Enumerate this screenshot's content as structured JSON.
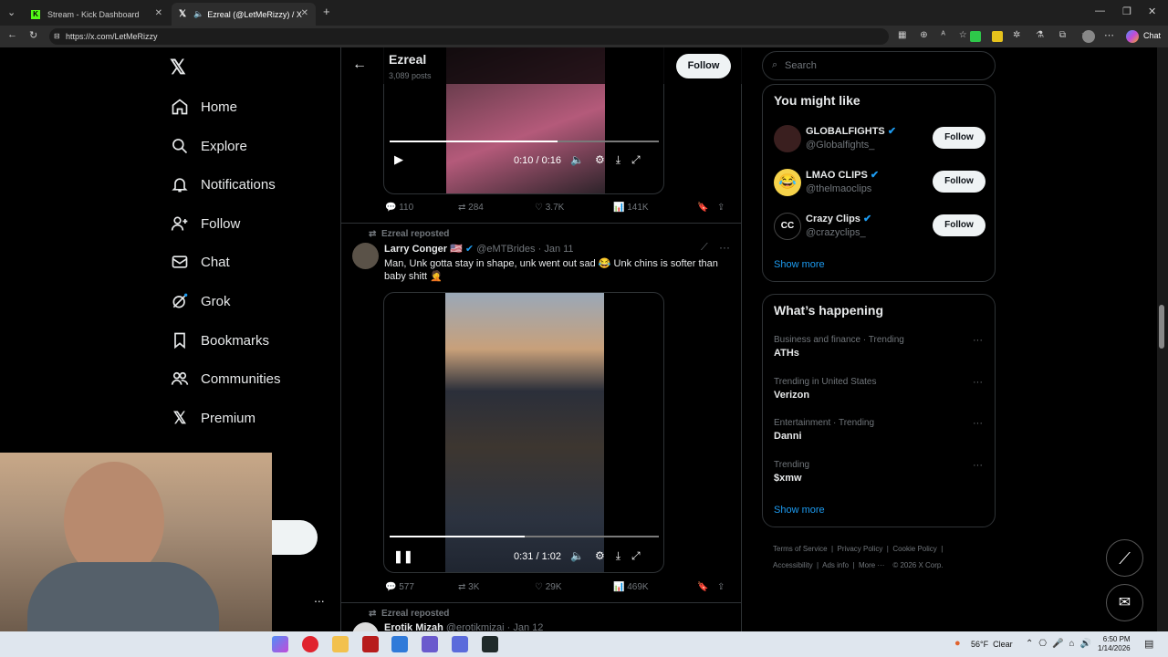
{
  "browser": {
    "tabs": [
      {
        "title": "Stream - Kick Dashboard"
      },
      {
        "title": "Ezreal (@LetMeRizzy) / X"
      }
    ],
    "url": "https://x.com/LetMeRizzy",
    "chat_label": "Chat"
  },
  "sidebar": {
    "items": [
      {
        "label": "Home",
        "icon": "home-icon"
      },
      {
        "label": "Explore",
        "icon": "search-icon"
      },
      {
        "label": "Notifications",
        "icon": "bell-icon"
      },
      {
        "label": "Follow",
        "icon": "person-add-icon"
      },
      {
        "label": "Chat",
        "icon": "mail-icon"
      },
      {
        "label": "Grok",
        "icon": "grok-icon"
      },
      {
        "label": "Bookmarks",
        "icon": "bookmark-icon"
      },
      {
        "label": "Communities",
        "icon": "people-icon"
      },
      {
        "label": "Premium",
        "icon": "x-icon"
      }
    ],
    "more_dots": "..."
  },
  "header": {
    "name": "Ezreal",
    "posts": "3,089 posts",
    "follow_label": "Follow"
  },
  "post1": {
    "time": "0:10 / 0:16",
    "replies": "110",
    "reposts": "284",
    "likes": "3.7K",
    "views": "141K"
  },
  "post2": {
    "repost_label": "Ezreal reposted",
    "author": "Larry Conger",
    "handle": "@eMTBrides",
    "date": "· Jan 11",
    "text": "Man, Unk gotta stay in shape, unk went out sad 😂 Unk chins is softer than baby shitt 🤦",
    "time": "0:31 / 1:02",
    "replies": "577",
    "reposts": "3K",
    "likes": "29K",
    "views": "469K"
  },
  "post3": {
    "repost_label": "Ezreal reposted",
    "author": "Erotik Mizah",
    "handle": "@erotikmizai",
    "date": "· Jan 12"
  },
  "search": {
    "placeholder": "Search"
  },
  "you_might_like": {
    "title": "You might like",
    "accounts": [
      {
        "name": "GLOBALFIGHTS",
        "handle": "@Globalfights_",
        "follow": "Follow"
      },
      {
        "name": "LMAO CLIPS",
        "handle": "@thelmaoclips",
        "follow": "Follow"
      },
      {
        "name": "Crazy Clips",
        "handle": "@crazyclips_",
        "follow": "Follow"
      }
    ],
    "show_more": "Show more"
  },
  "happening": {
    "title": "What’s happening",
    "trends": [
      {
        "category": "Business and finance · Trending",
        "name": "ATHs"
      },
      {
        "category": "Trending in United States",
        "name": "Verizon"
      },
      {
        "category": "Entertainment · Trending",
        "name": "Danni"
      },
      {
        "category": "Trending",
        "name": "$xmw"
      }
    ],
    "show_more": "Show more"
  },
  "footer": {
    "links": [
      "Terms of Service",
      "Privacy Policy",
      "Cookie Policy",
      "Accessibility",
      "Ads info",
      "More ···",
      "© 2026 X Corp."
    ]
  },
  "taskbar": {
    "weather": "56°F",
    "weather_desc": "Clear",
    "time": "6:50 PM",
    "date": "1/14/2026"
  },
  "colors": {
    "verified": "#1d9bf0",
    "kick_green": "#53fc18",
    "background": "#000000"
  }
}
